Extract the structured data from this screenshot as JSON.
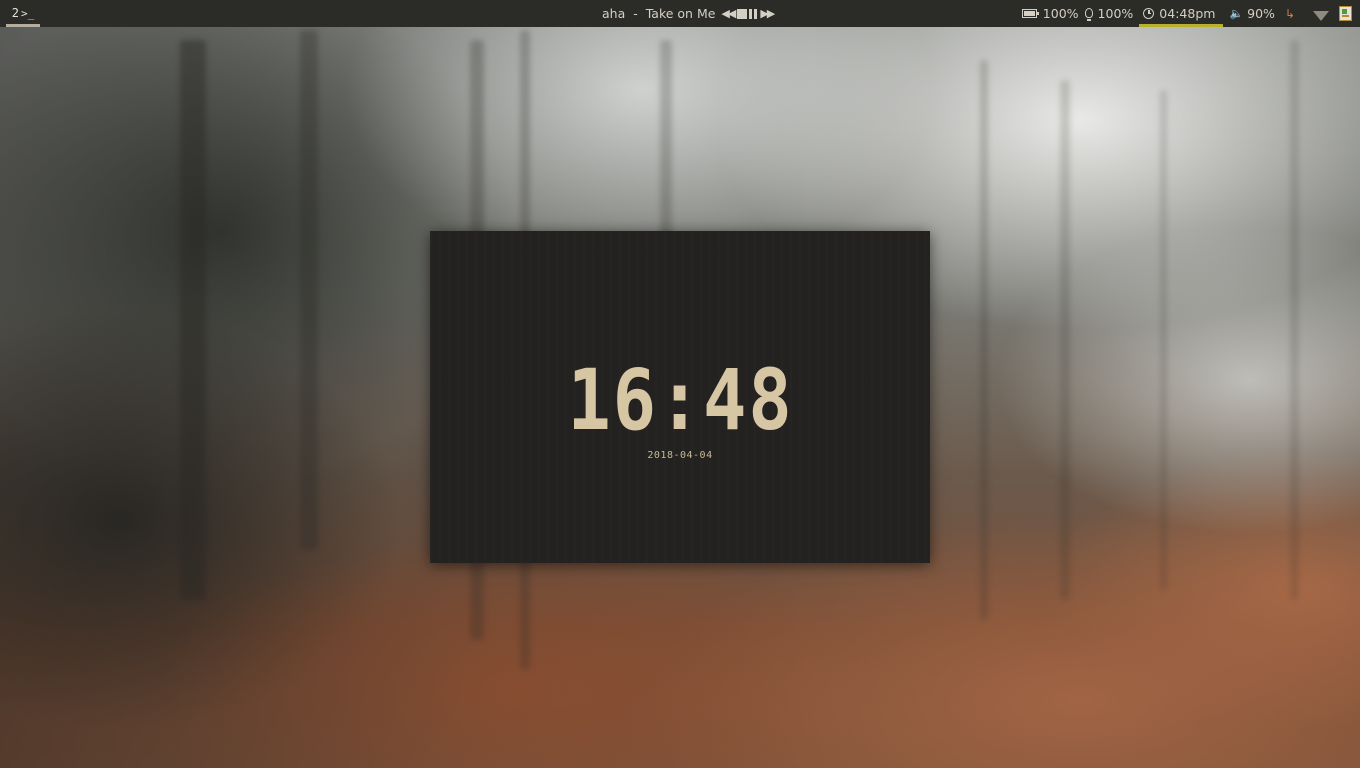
{
  "topbar": {
    "workspace": {
      "number": "2",
      "icon_glyph": ">_"
    },
    "media": {
      "artist": "aha",
      "separator": " - ",
      "track": "Take on Me",
      "controls": [
        "previous-icon",
        "stop-icon",
        "pause-icon",
        "next-icon"
      ]
    },
    "status": {
      "battery": "100%",
      "brightness": "100%",
      "clock": "04:48pm",
      "volume": "90%"
    },
    "colors": {
      "bar_bg": "#2b2b28",
      "clock_underline": "#b7b02b",
      "power_icon": "#e07a2a"
    }
  },
  "lock": {
    "time": "16:48",
    "date": "2018-04-04",
    "colors": {
      "panel_bg": "#232220",
      "time_fg": "#d6c6a4"
    }
  }
}
